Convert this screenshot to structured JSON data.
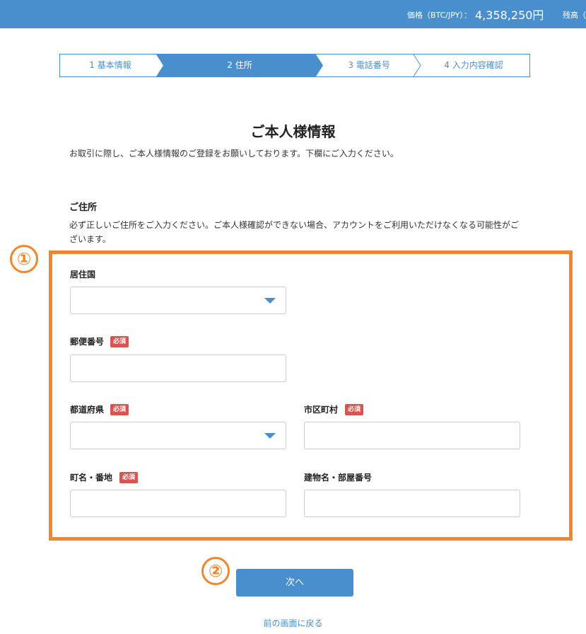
{
  "header": {
    "price_label": "価格（BTC/JPY）：",
    "price_value": "4,358,250円",
    "balance_label": "残高（"
  },
  "steps": [
    {
      "label": "1 基本情報",
      "active": false
    },
    {
      "label": "2 住所",
      "active": true
    },
    {
      "label": "3 電話番号",
      "active": false
    },
    {
      "label": "4 入力内容確認",
      "active": false
    }
  ],
  "page": {
    "title": "ご本人様情報",
    "intro": "お取引に際し、ご本人様情報のご登録をお願いしております。下欄にご入力ください。"
  },
  "address_section": {
    "title": "ご住所",
    "description": "必ず正しいご住所をご入力ください。ご本人様確認ができない場合、アカウントをご利用いただけなくなる可能性がございます。"
  },
  "form": {
    "required_badge": "必須",
    "country": {
      "label": "居住国",
      "value": ""
    },
    "postal_code": {
      "label": "郵便番号",
      "value": ""
    },
    "prefecture": {
      "label": "都道府県",
      "value": ""
    },
    "city": {
      "label": "市区町村",
      "value": ""
    },
    "street": {
      "label": "町名・番地",
      "value": ""
    },
    "building": {
      "label": "建物名・部屋番号",
      "value": ""
    }
  },
  "annotations": {
    "marker1": "①",
    "marker2": "②"
  },
  "actions": {
    "next_label": "次へ",
    "back_label": "前の画面に戻る"
  },
  "colors": {
    "accent": "#4a8fcd",
    "highlight": "#f5852b",
    "required": "#d9534f"
  }
}
